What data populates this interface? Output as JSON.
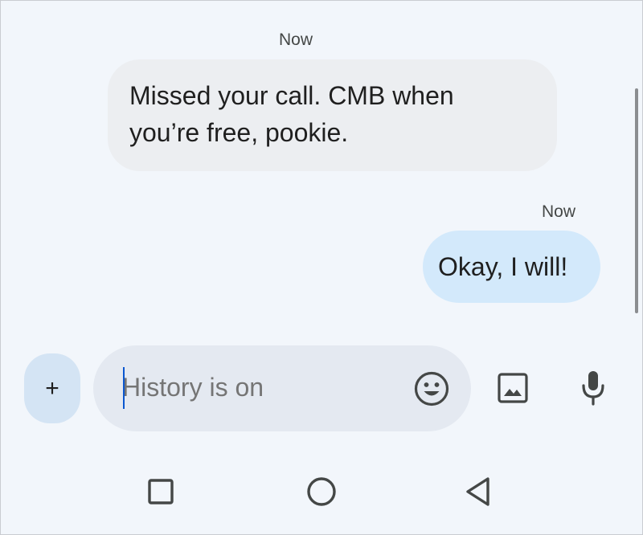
{
  "conversation": {
    "messages": [
      {
        "direction": "incoming",
        "timestamp": "Now",
        "text_line1": "Missed your call. CMB when",
        "text_line2": "you’re free, pookie."
      },
      {
        "direction": "outgoing",
        "timestamp": "Now",
        "text": "Okay, I will!"
      }
    ]
  },
  "composer": {
    "add_label": "+",
    "placeholder": "History is on",
    "value": "",
    "icons": {
      "add": "plus-icon",
      "emoji": "smiley-face-icon",
      "image": "image-gallery-icon",
      "mic": "microphone-icon"
    }
  },
  "nav_bar": {
    "icons": [
      "recents-square-icon",
      "home-circle-icon",
      "back-triangle-icon"
    ]
  },
  "colors": {
    "background": "#f2f6fb",
    "incoming_bubble": "#eceef1",
    "outgoing_bubble": "#d3e9fb",
    "compose_pill": "#e4e9f1",
    "add_button": "#d4e4f4",
    "caret": "#0b57d0"
  }
}
